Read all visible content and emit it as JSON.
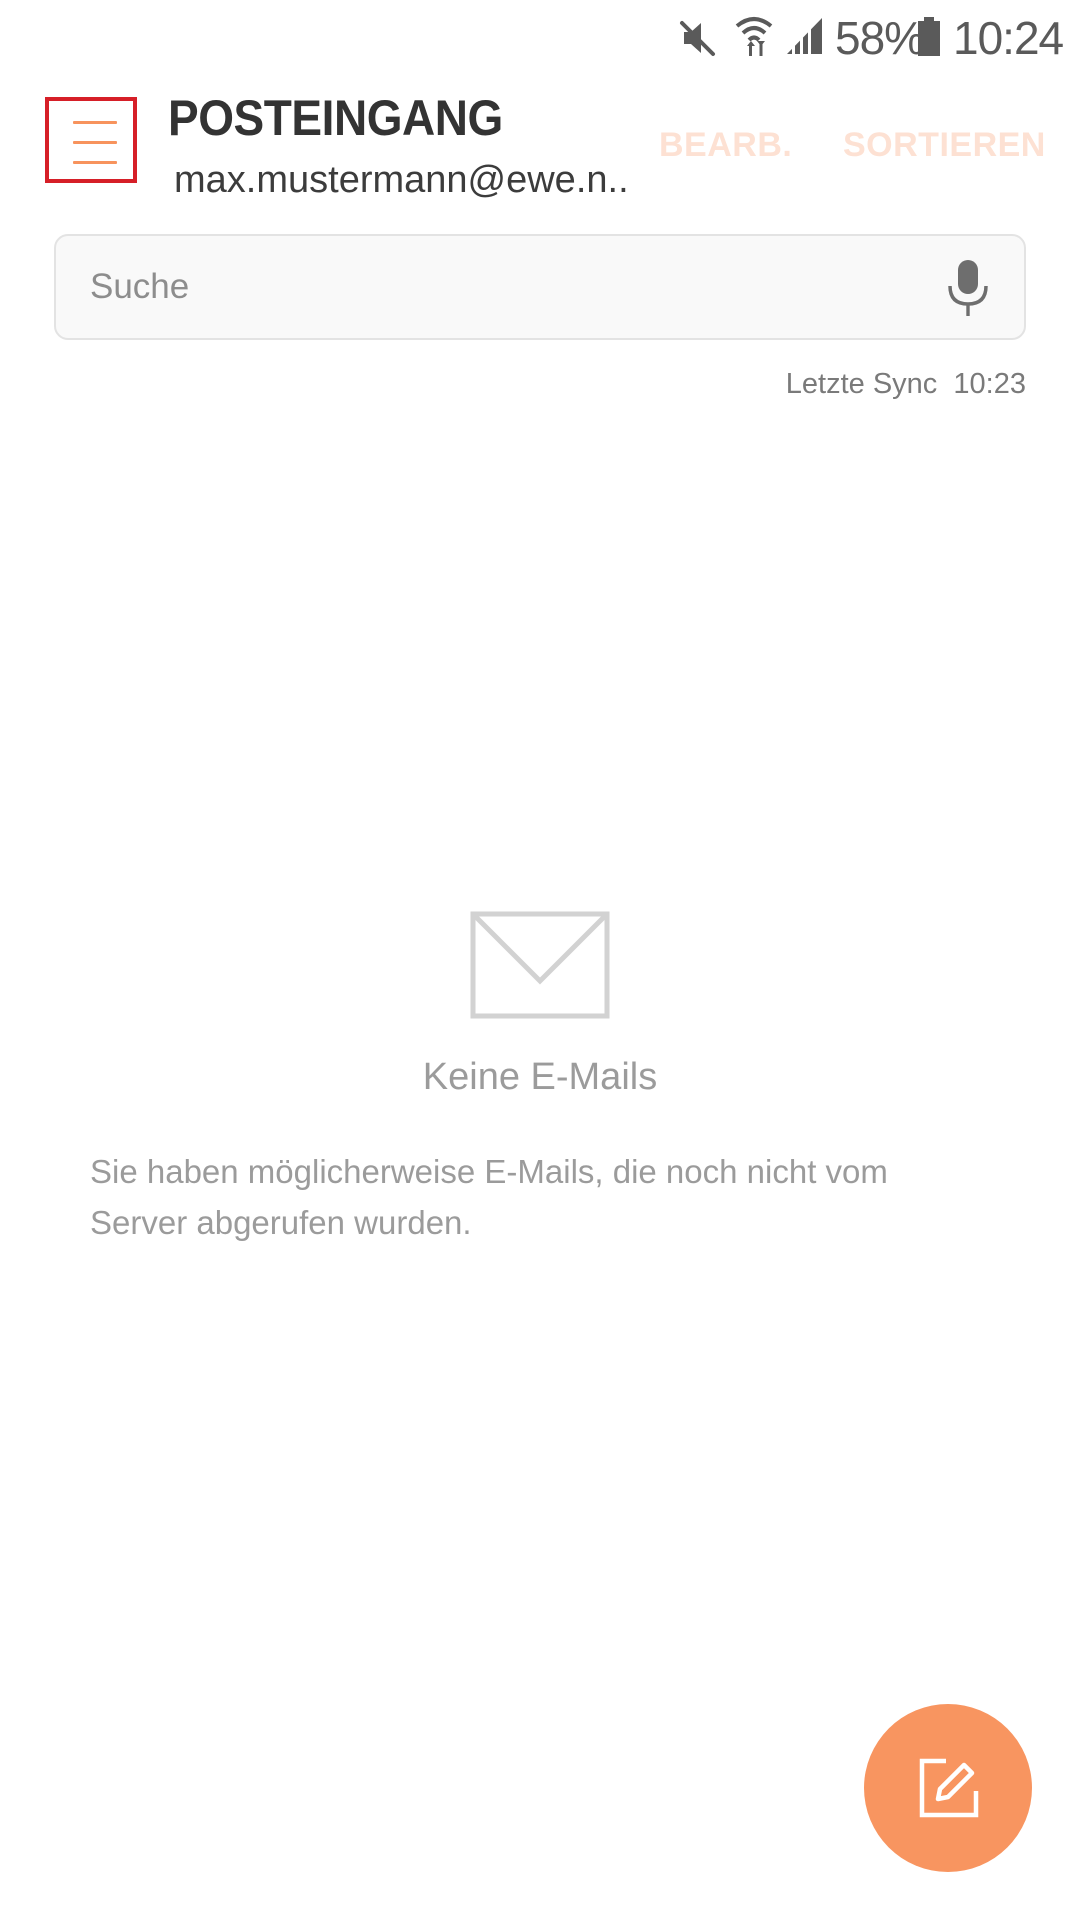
{
  "status_bar": {
    "icons": [
      "mute-icon",
      "wifi-icon",
      "signal-icon",
      "battery-icon"
    ],
    "battery_text": "58%",
    "time": "10:24"
  },
  "header": {
    "menu_icon": "hamburger-menu-icon",
    "title": "POSTEINGANG",
    "account": "max.mustermann@ewe.n..",
    "actions": {
      "edit": "BEARB.",
      "sort": "SORTIEREN"
    }
  },
  "search": {
    "placeholder": "Suche",
    "value": "",
    "icon": "microphone-icon"
  },
  "sync": {
    "label": "Letzte Sync  10:23"
  },
  "empty_state": {
    "icon": "envelope-icon",
    "title": "Keine E-Mails",
    "message": "Sie haben möglicherweise E-Mails, die noch nicht vom Server abgerufen wurden."
  },
  "fab": {
    "icon": "compose-icon"
  },
  "colors": {
    "accent": "#f89560",
    "accent_faded": "#fde1d3",
    "highlight_border": "#d61f28",
    "title": "#333333",
    "muted_text": "#9b9b9b",
    "background": "#ffffff"
  }
}
